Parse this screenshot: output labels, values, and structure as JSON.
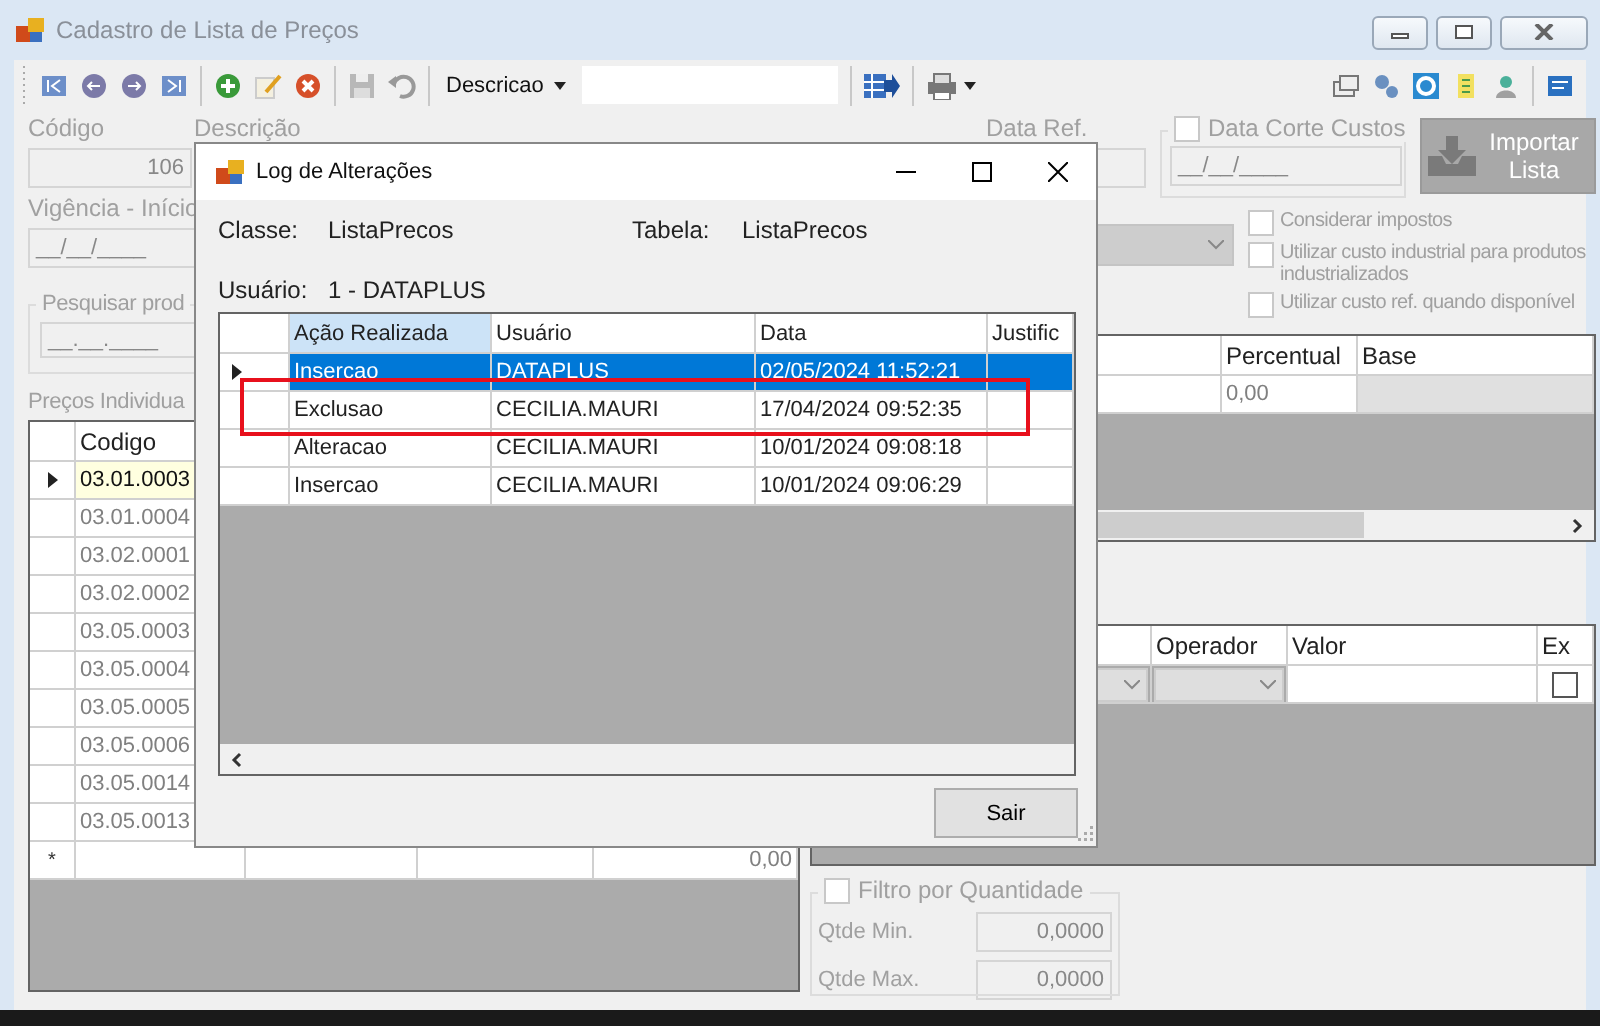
{
  "window": {
    "title": "Cadastro de Lista de Preços"
  },
  "toolbar": {
    "field_selector": "Descricao"
  },
  "form": {
    "codigo": {
      "label": "Código",
      "value": "106"
    },
    "descricao": {
      "label": "Descrição"
    },
    "data_ref": {
      "label": "Data Ref."
    },
    "data_corte": {
      "label": "Data Corte Custos",
      "checked": false,
      "value": "__/__/____"
    },
    "import_button": "Importar Lista",
    "vigencia": {
      "label": "Vigência - Início",
      "value": "__/__/____"
    },
    "options": [
      {
        "label": "Considerar impostos",
        "checked": false
      },
      {
        "label": "Utilizar custo industrial para produtos industrializados",
        "checked": false
      },
      {
        "label": "Utilizar custo ref. quando disponível",
        "checked": false
      }
    ],
    "pesquisar": {
      "label": "Pesquisar prod",
      "value": "__.__.____"
    },
    "precos_label": "Preços Individua"
  },
  "prices_table": {
    "columns": [
      "Codigo"
    ],
    "new_row_marker": "*",
    "new_row_value": "0,00",
    "rows": [
      {
        "codigo": "03.01.0003",
        "selected": true
      },
      {
        "codigo": "03.01.0004",
        "selected": false
      },
      {
        "codigo": "03.02.0001",
        "selected": false
      },
      {
        "codigo": "03.02.0002",
        "selected": false
      },
      {
        "codigo": "03.05.0003",
        "selected": false
      },
      {
        "codigo": "03.05.0004",
        "selected": false
      },
      {
        "codigo": "03.05.0005",
        "selected": false
      },
      {
        "codigo": "03.05.0006",
        "selected": false
      },
      {
        "codigo": "03.05.0014",
        "selected": false
      },
      {
        "codigo": "03.05.0013",
        "selected": false
      }
    ]
  },
  "discount_table": {
    "columns": [
      "Percentual",
      "Base"
    ],
    "rows": [
      {
        "percentual": "0,00"
      }
    ]
  },
  "filter_table": {
    "columns": [
      "Operador",
      "Valor",
      "Ex"
    ],
    "rows": [
      {
        "ex": false
      }
    ]
  },
  "quantity_filter": {
    "label": "Filtro por Quantidade",
    "checked": false,
    "min_label": "Qtde Min.",
    "min_value": "0,0000",
    "max_label": "Qtde Max.",
    "max_value": "0,0000"
  },
  "dialog": {
    "title": "Log de Alterações",
    "classe_label": "Classe:",
    "classe_value": "ListaPrecos",
    "tabela_label": "Tabela:",
    "tabela_value": "ListaPrecos",
    "usuario_label": "Usuário:",
    "usuario_value": "1 - DATAPLUS",
    "table": {
      "columns": [
        "Ação Realizada",
        "Usuário",
        "Data",
        "Justific"
      ],
      "rows": [
        {
          "acao": "Insercao",
          "usuario": "DATAPLUS",
          "data": "02/05/2024 11:52:21",
          "selected": true
        },
        {
          "acao": "Exclusao",
          "usuario": "CECILIA.MAURI",
          "data": "17/04/2024 09:52:35",
          "selected": false
        },
        {
          "acao": "Alteracao",
          "usuario": "CECILIA.MAURI",
          "data": "10/01/2024 09:08:18",
          "selected": false
        },
        {
          "acao": "Insercao",
          "usuario": "CECILIA.MAURI",
          "data": "10/01/2024 09:06:29",
          "selected": false
        }
      ]
    },
    "close_button": "Sair"
  }
}
